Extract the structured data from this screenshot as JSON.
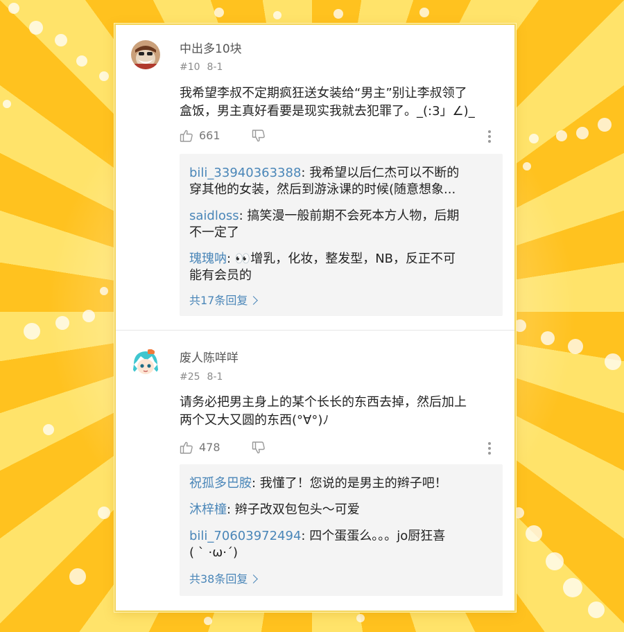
{
  "comments": [
    {
      "username": "中出多10块",
      "floor": "#10",
      "date": "8-1",
      "text": "我希望李叔不定期疯狂送女装给“男主”别让李叔领了\n盒饭，男主真好看要是现实我就去犯罪了。_(:3」∠)_",
      "likes": "661",
      "replies": [
        {
          "user": "bili_33940363388",
          "text": ": 我希望以后仁杰可以不断的\n穿其他的女装，然后到游泳课的时候(随意想象..."
        },
        {
          "user": "saidloss",
          "text": ": 搞笑漫一般前期不会死本方人物，后期\n不一定了"
        },
        {
          "user": "瑰瑰呐",
          "text": ": 👀增乳，化妆，整发型，NB，反正不可\n能有会员的"
        }
      ],
      "more_replies": "共17条回复"
    },
    {
      "username": "废人陈咩咩",
      "floor": "#25",
      "date": "8-1",
      "text": "请务必把男主身上的某个长长的东西去掉，然后加上\n两个又大又圆的东西(°∀°)ﾉ",
      "likes": "478",
      "replies": [
        {
          "user": "祝孤多巴胺",
          "text": ": 我懂了！您说的是男主的辫子吧！"
        },
        {
          "user": "沐梓橦",
          "text": ": 辫子改双包包头～可爱"
        },
        {
          "user": "bili_70603972494",
          "text": ": 四个蛋蛋么。。。jo厨狂喜\n( ` ·ω·´)"
        }
      ],
      "more_replies": "共38条回复"
    }
  ],
  "icons": {
    "like": "thumbs-up-icon",
    "dislike": "thumbs-down-icon",
    "more": "more-vertical-icon"
  },
  "colors": {
    "link": "#4a86b8",
    "background": "#ffd23a"
  }
}
